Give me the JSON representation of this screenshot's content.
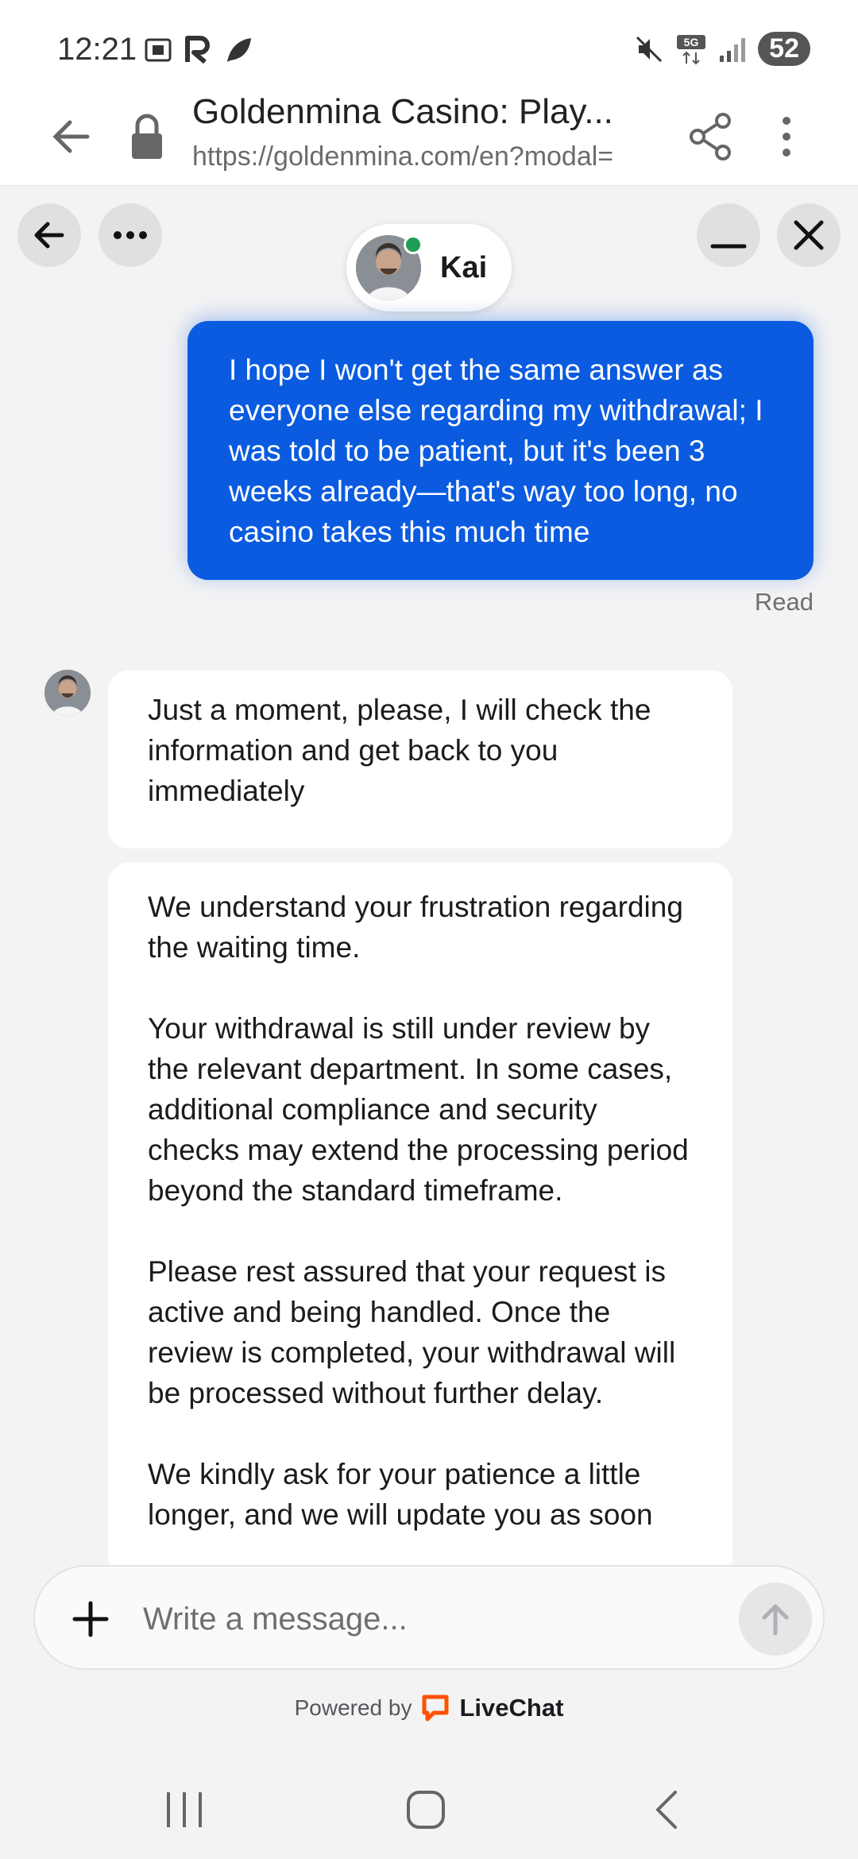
{
  "status_bar": {
    "time": "12:21",
    "battery": "52",
    "network": "5G"
  },
  "browser": {
    "title": "Goldenmina Casino: Play...",
    "url": "https://goldenmina.com/en?modal="
  },
  "chat": {
    "agent_name": "Kai",
    "agent_status_color": "#1f9d55",
    "user_message": "I hope I won't get the same answer as everyone else regarding my withdrawal; I was told to be patient, but it's been 3 weeks already—that's way too long, no casino takes this much time",
    "read_status": "Read",
    "agent_messages": {
      "first": "Just a moment, please, I will check the information and get back to you immediately",
      "second_p1": "We understand your frustration regarding the waiting time.",
      "second_p2": "Your withdrawal is still under review by the relevant department. In some cases, additional compliance and security checks may extend the processing period beyond the standard timeframe.",
      "second_p3": "Please rest assured that your request is active and being handled. Once the review is completed, your withdrawal will be processed without further delay.",
      "second_p4": "We kindly ask for your patience a little longer, and we will update you as soon"
    }
  },
  "composer": {
    "placeholder": "Write a message..."
  },
  "footer": {
    "powered_by": "Powered by",
    "brand": "LiveChat",
    "brand_color": "#ff5100"
  },
  "colors": {
    "user_bubble": "#0a5be0",
    "agent_bubble": "#ffffff",
    "background": "#f3f3f4"
  }
}
